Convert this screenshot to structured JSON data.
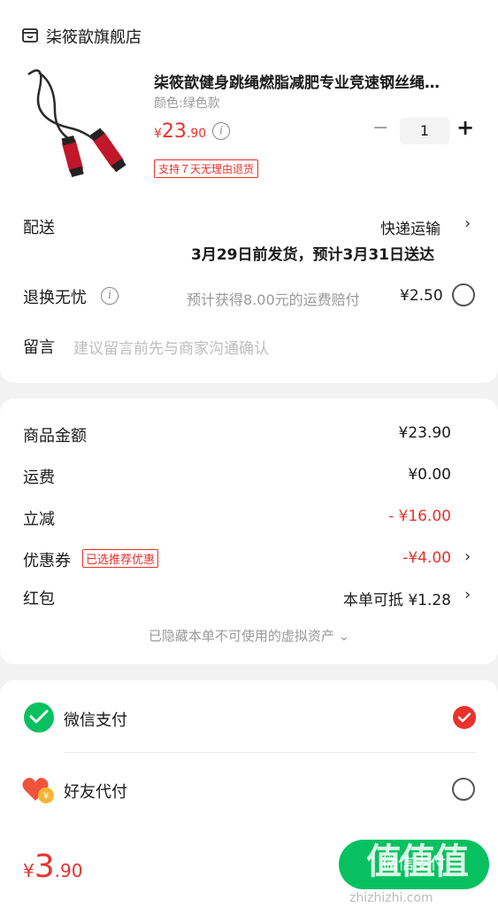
{
  "store": {
    "name": "柒筱歆旗舰店",
    "icon": "store-icon"
  },
  "product": {
    "title": "柒筱歆健身跳绳燃脂减肥专业竞速钢丝绳…",
    "variant": "颜色:绿色款",
    "price_symbol": "¥",
    "price_int": "23",
    "price_dec": ".90",
    "badge": "支持７天无理由退货",
    "quantity": "1",
    "minus": "−",
    "plus": "+"
  },
  "delivery": {
    "label": "配送",
    "method": "快递运输",
    "eta": "3月29日前发货，预计3月31日送达"
  },
  "returns": {
    "label": "退换无忧",
    "desc": "预计获得8.00元的运费赔付",
    "price": "¥2.50"
  },
  "message": {
    "label": "留言",
    "placeholder": "建议留言前先与商家沟通确认"
  },
  "summary": {
    "goods_label": "商品金额",
    "goods_value": "¥23.90",
    "shipping_label": "运费",
    "shipping_value": "¥0.00",
    "discount_label": "立减",
    "discount_value": "- ¥16.00",
    "coupon_label": "优惠券",
    "coupon_tag": "已选推荐优惠",
    "coupon_value": "-¥4.00",
    "redpacket_label": "红包",
    "redpacket_value": "本单可抵 ¥1.28",
    "hidden_assets": "已隐藏本单不可使用的虚拟资产 ⌄"
  },
  "payment": {
    "wechat_label": "微信支付",
    "friend_label": "好友代付"
  },
  "footer": {
    "total_symbol": "¥",
    "total_int": "3",
    "total_dec": ".90",
    "pay_button": "微信支付",
    "watermark": "值值值",
    "watermark_url": "zhizhizhi.com"
  },
  "colors": {
    "accent": "#e8322c",
    "wechat": "#07c160"
  }
}
